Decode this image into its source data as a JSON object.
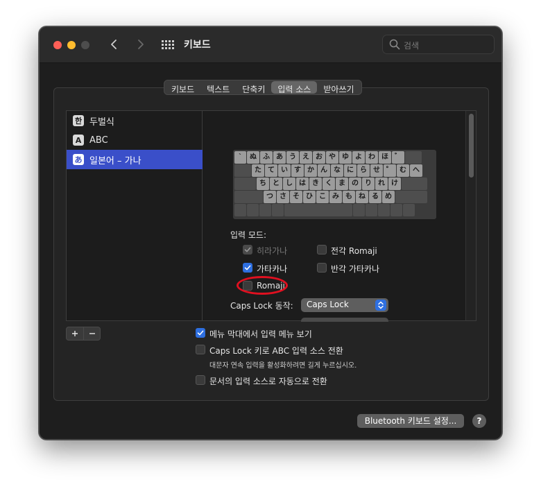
{
  "window": {
    "title": "키보드"
  },
  "search": {
    "placeholder": "검색"
  },
  "tabs": [
    {
      "label": "키보드",
      "active": false
    },
    {
      "label": "텍스트",
      "active": false
    },
    {
      "label": "단축키",
      "active": false
    },
    {
      "label": "입력 소스",
      "active": true
    },
    {
      "label": "받아쓰기",
      "active": false
    }
  ],
  "sources": [
    {
      "icon": "한",
      "label": "두벌식",
      "selected": false
    },
    {
      "icon": "A",
      "label": "ABC",
      "selected": false
    },
    {
      "icon": "あ",
      "label": "일본어 – 가나",
      "selected": true
    }
  ],
  "keyboard_rows": [
    [
      "`",
      "ぬ",
      "ふ",
      "あ",
      "う",
      "え",
      "お",
      "や",
      "ゆ",
      "よ",
      "わ",
      "ほ",
      "゛",
      ""
    ],
    [
      "",
      "た",
      "て",
      "い",
      "す",
      "か",
      "ん",
      "な",
      "に",
      "ら",
      "せ",
      "゜",
      "む",
      "へ"
    ],
    [
      "",
      "ち",
      "と",
      "し",
      "は",
      "き",
      "く",
      "ま",
      "の",
      "り",
      "れ",
      "け",
      ""
    ],
    [
      "",
      "つ",
      "さ",
      "そ",
      "ひ",
      "こ",
      "み",
      "も",
      "ね",
      "る",
      "め",
      ""
    ],
    [
      "",
      "",
      "",
      "",
      "",
      "",
      "",
      "",
      "",
      ""
    ]
  ],
  "input_modes": {
    "label": "입력 모드:",
    "hiragana": {
      "label": "히라가나",
      "checked": true,
      "enabled": false
    },
    "katakana": {
      "label": "가타카나",
      "checked": true,
      "enabled": true
    },
    "romaji": {
      "label": "Romaji",
      "checked": false,
      "enabled": true
    },
    "fullwidth_romaji": {
      "label": "전각 Romaji",
      "checked": false,
      "enabled": true
    },
    "halfwidth_katakana": {
      "label": "반각 가타카나",
      "checked": false,
      "enabled": true
    }
  },
  "caps_lock": {
    "label": "Caps Lock 동작:",
    "value": "Caps Lock"
  },
  "options": {
    "show_menu": {
      "label": "메뉴 막대에서 입력 메뉴 보기",
      "checked": true
    },
    "caps_switch": {
      "label": "Caps Lock 키로 ABC 입력 소스 전환",
      "checked": false,
      "note": "대문자 연속 입력을 활성화하려면 길게 누르십시오."
    },
    "auto_switch": {
      "label": "문서의 입력 소스로 자동으로 전환",
      "checked": false
    }
  },
  "buttons": {
    "add": "+",
    "remove": "−",
    "bluetooth": "Bluetooth 키보드 설정...",
    "help": "?"
  },
  "colors": {
    "accent": "#2e6fe0",
    "selection": "#3a4fc9",
    "annotation": "#e01020"
  }
}
